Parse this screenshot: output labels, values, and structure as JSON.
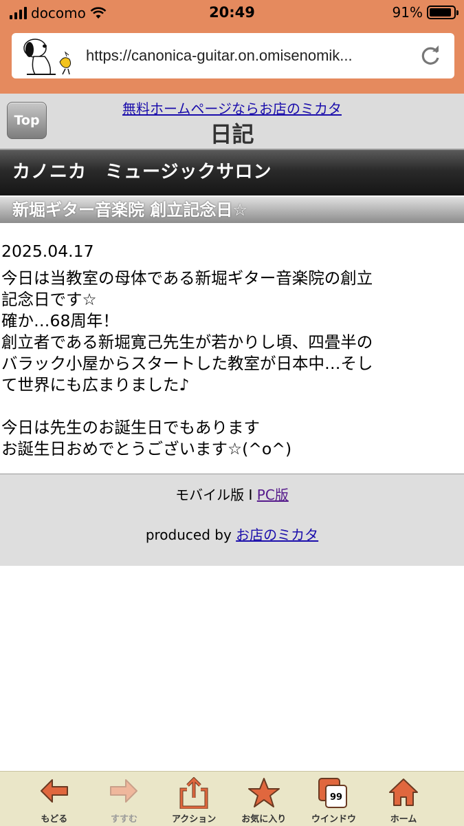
{
  "status": {
    "carrier": "docomo",
    "time": "20:49",
    "battery": "91%",
    "battery_level": 0.91
  },
  "browser": {
    "url": "https://canonica-guitar.on.omisenomik...",
    "toolbar": [
      {
        "label": "もどる",
        "icon": "back-arrow-icon"
      },
      {
        "label": "すすむ",
        "icon": "forward-arrow-icon"
      },
      {
        "label": "アクション",
        "icon": "share-icon"
      },
      {
        "label": "お気に入り",
        "icon": "star-icon"
      },
      {
        "label": "ウインドウ",
        "icon": "windows-icon",
        "badge": "99"
      },
      {
        "label": "ホーム",
        "icon": "home-icon"
      }
    ]
  },
  "page": {
    "top_button": "Top",
    "ad_link": "無料ホームページならお店のミカタ",
    "title": "日記",
    "site_name": "カノニカ　ミュージックサロン",
    "entry_title": "新堀ギター音楽院 創立記念日☆",
    "date": "2025.04.17",
    "lines": [
      "今日は当教室の母体である新堀ギター音楽院の創立",
      "記念日です☆",
      "確か…68周年！",
      "創立者である新堀寛己先生が若かりし頃、四畳半の",
      "バラック小屋からスタートした教室が日本中…そし",
      "て世界にも広まりました♪",
      "",
      "今日は先生のお誕生日でもあります",
      "お誕生日おめでとうございます☆(^o^)"
    ]
  },
  "footer": {
    "mobile_label": "モバイル版",
    "separator": "I",
    "pc_link": "PC版",
    "produced_by": "produced by",
    "produced_link": "お店のミカタ"
  },
  "colors": {
    "accent": "#e58a5e",
    "toolbar_icon": "#e0673e",
    "link": "#1a0dab"
  }
}
